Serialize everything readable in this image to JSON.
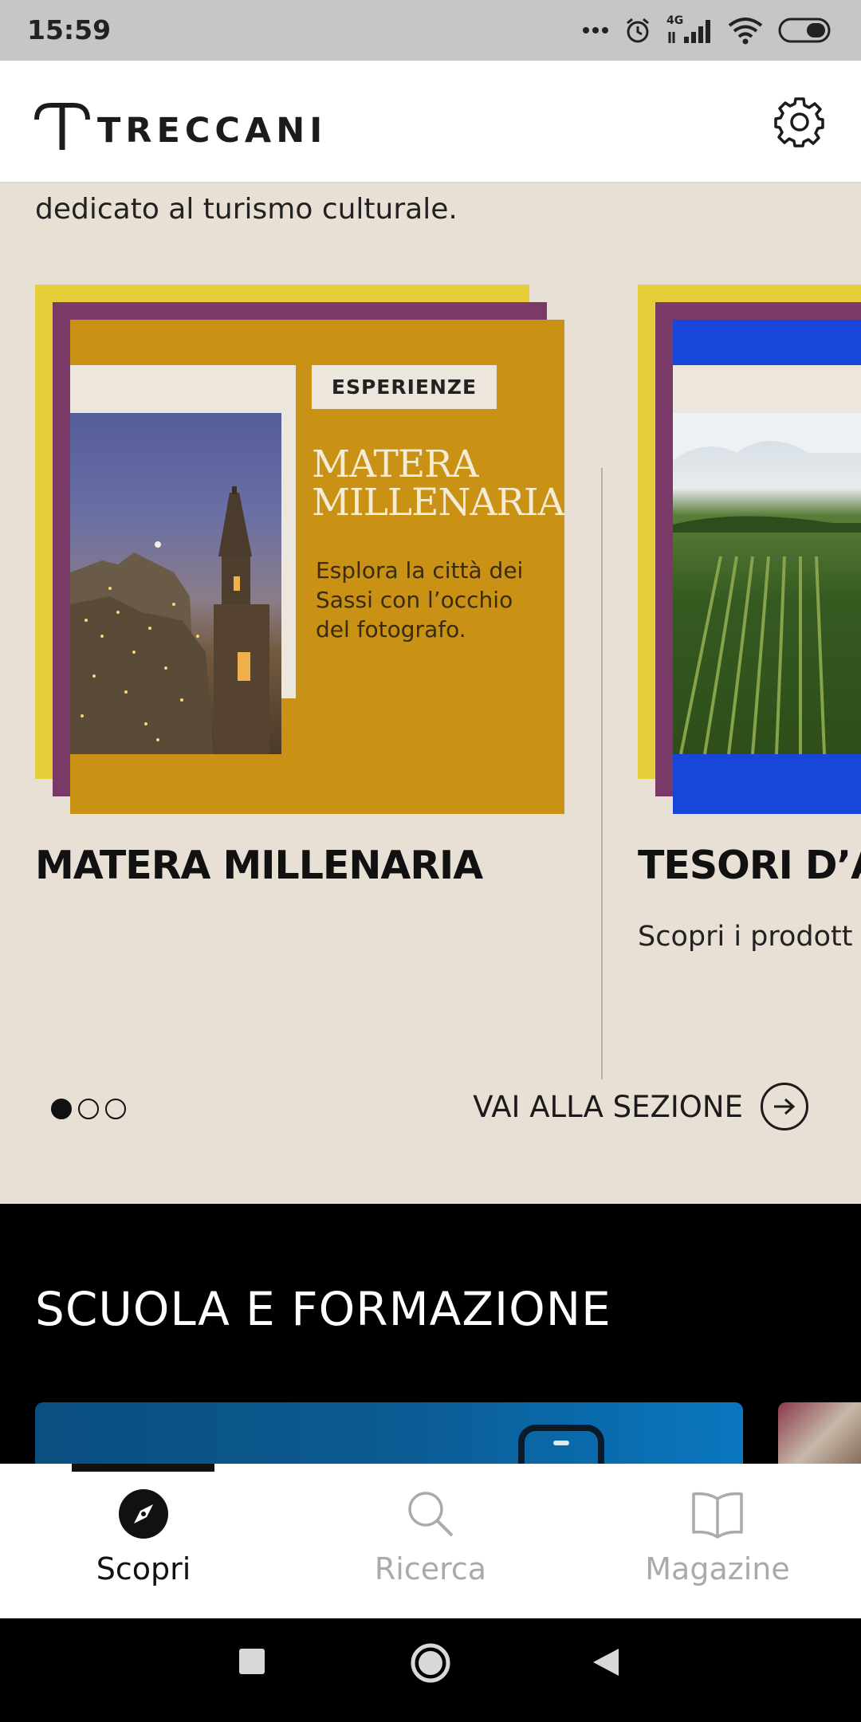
{
  "status_bar": {
    "time": "15:59",
    "network": "4G",
    "icons": [
      "more-dots-icon",
      "alarm-icon",
      "signal-icon",
      "wifi-icon",
      "battery-icon"
    ]
  },
  "header": {
    "logo_text": "TRECCANI",
    "settings_icon": "gear-icon"
  },
  "culture_section": {
    "intro_text": "dedicato al turismo culturale.",
    "cards": [
      {
        "badge": "ESPERIENZE",
        "poster_title": "MATERA\nMILLENARIA",
        "poster_description": "Esplora la città dei\nSassi con l’occhio\ndel fotografo.",
        "title": "MATERA MILLENARIA",
        "text": ""
      },
      {
        "title": "TESORI D’A",
        "text": "Scopri i prodott un menu stella"
      }
    ],
    "pagination": {
      "total": 3,
      "active": 1
    },
    "section_link_label": "VAI ALLA SEZIONE"
  },
  "school_section": {
    "title": "SCUOLA E FORMAZIONE"
  },
  "bottom_nav": {
    "items": [
      {
        "label": "Scopri",
        "icon": "compass-icon",
        "active": true
      },
      {
        "label": "Ricerca",
        "icon": "search-icon",
        "active": false
      },
      {
        "label": "Magazine",
        "icon": "book-icon",
        "active": false
      }
    ]
  },
  "system_nav": {
    "buttons": [
      "recents-square-icon",
      "home-circle-icon",
      "back-triangle-icon"
    ]
  },
  "colors": {
    "section_bg": "#e8dfd5",
    "poster_gold": "#c99214",
    "poster_blue": "#1846d8",
    "frame_yellow": "#e6cd3a",
    "frame_purple": "#7a3a68"
  }
}
